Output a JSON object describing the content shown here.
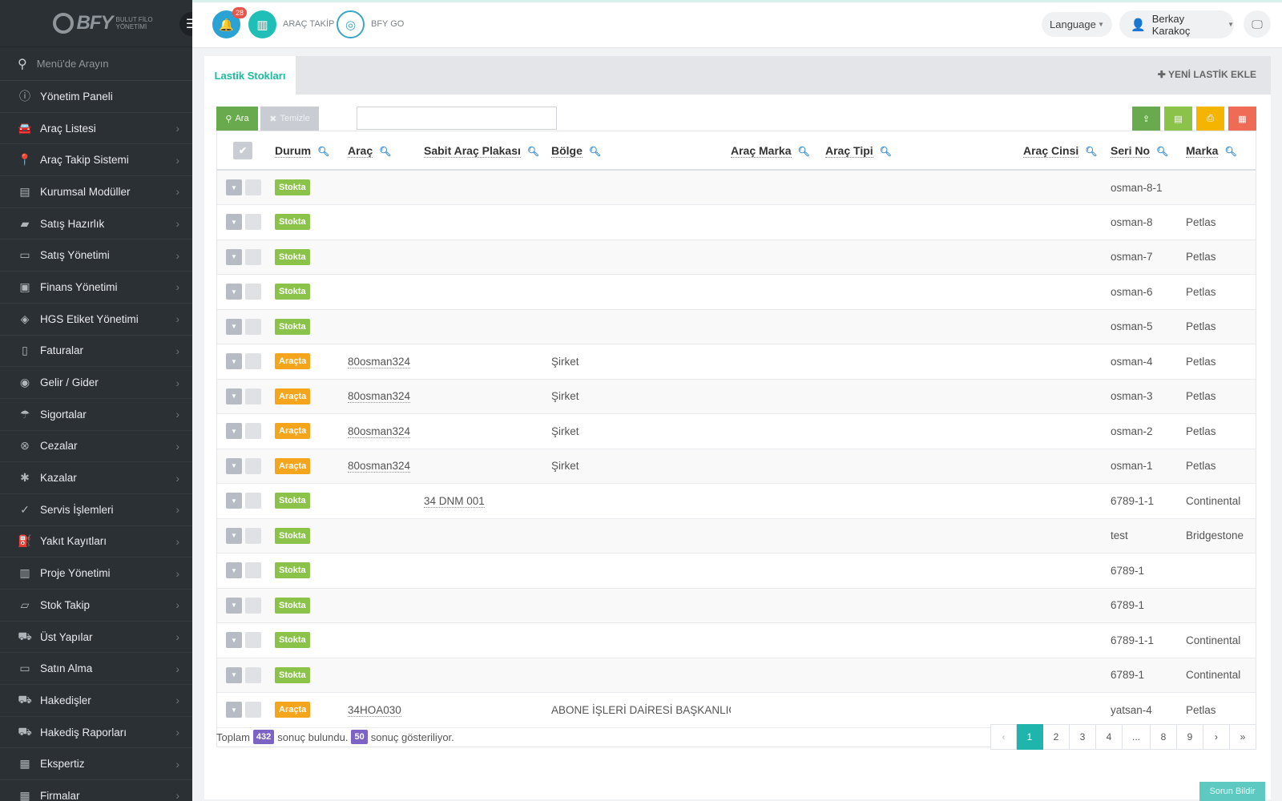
{
  "brand": {
    "name": "BFY",
    "subtitle": "BULUT FİLO YÖNETİMİ"
  },
  "sidebar": {
    "search_placeholder": "Menü'de Arayın",
    "items": [
      {
        "label": "Yönetim Paneli",
        "icon": "info-circle-icon",
        "chevron": false
      },
      {
        "label": "Araç Listesi",
        "icon": "car-icon",
        "chevron": true
      },
      {
        "label": "Araç Takip Sistemi",
        "icon": "map-pin-icon",
        "chevron": true
      },
      {
        "label": "Kurumsal Modüller",
        "icon": "server-icon",
        "chevron": true
      },
      {
        "label": "Satış Hazırlık",
        "icon": "book-icon",
        "chevron": true
      },
      {
        "label": "Satış Yönetimi",
        "icon": "credit-card-icon",
        "chevron": true
      },
      {
        "label": "Finans Yönetimi",
        "icon": "money-icon",
        "chevron": true
      },
      {
        "label": "HGS Etiket Yönetimi",
        "icon": "tag-icon",
        "chevron": true
      },
      {
        "label": "Faturalar",
        "icon": "file-icon",
        "chevron": true
      },
      {
        "label": "Gelir / Gider",
        "icon": "coins-icon",
        "chevron": true
      },
      {
        "label": "Sigortalar",
        "icon": "umbrella-icon",
        "chevron": true
      },
      {
        "label": "Cezalar",
        "icon": "x-circle-icon",
        "chevron": true
      },
      {
        "label": "Kazalar",
        "icon": "car-crash-icon",
        "chevron": true
      },
      {
        "label": "Servis İşlemleri",
        "icon": "check-circle-icon",
        "chevron": true
      },
      {
        "label": "Yakıt Kayıtları",
        "icon": "fuel-icon",
        "chevron": true
      },
      {
        "label": "Proje Yönetimi",
        "icon": "briefcase-icon",
        "chevron": true
      },
      {
        "label": "Stok Takip",
        "icon": "inbox-icon",
        "chevron": true
      },
      {
        "label": "Üst Yapılar",
        "icon": "truck-icon",
        "chevron": true
      },
      {
        "label": "Satın Alma",
        "icon": "credit-card-icon",
        "chevron": true
      },
      {
        "label": "Hakedişler",
        "icon": "truck-icon",
        "chevron": true
      },
      {
        "label": "Hakediş Raporları",
        "icon": "truck-icon",
        "chevron": true
      },
      {
        "label": "Ekspertiz",
        "icon": "document-icon",
        "chevron": true
      },
      {
        "label": "Firmalar",
        "icon": "building-icon",
        "chevron": true
      }
    ]
  },
  "topbar": {
    "notifications_count": "28",
    "arac_takip_label": "ARAÇ TAKİP",
    "bfy_go_label": "BFY GO",
    "language_label": "Language",
    "user_name": "Berkay Karakoç"
  },
  "panel": {
    "tab_label": "Lastik Stokları",
    "new_tire_label": "YENİ LASTİK EKLE",
    "search_button": "Ara",
    "clear_button": "Temizle",
    "search_value": ""
  },
  "table": {
    "columns": [
      "Durum",
      "Araç",
      "Sabit Araç Plakası",
      "Bölge",
      "Araç Marka",
      "Araç Tipi",
      "Araç Cinsi",
      "Seri No",
      "Marka"
    ],
    "rows": [
      {
        "durum": "Stokta",
        "status": "stok",
        "arac": "",
        "plaka": "",
        "bolge": "",
        "seri": "osman-8-1",
        "marka": ""
      },
      {
        "durum": "Stokta",
        "status": "stok",
        "arac": "",
        "plaka": "",
        "bolge": "",
        "seri": "osman-8",
        "marka": "Petlas"
      },
      {
        "durum": "Stokta",
        "status": "stok",
        "arac": "",
        "plaka": "",
        "bolge": "",
        "seri": "osman-7",
        "marka": "Petlas"
      },
      {
        "durum": "Stokta",
        "status": "stok",
        "arac": "",
        "plaka": "",
        "bolge": "",
        "seri": "osman-6",
        "marka": "Petlas"
      },
      {
        "durum": "Stokta",
        "status": "stok",
        "arac": "",
        "plaka": "",
        "bolge": "",
        "seri": "osman-5",
        "marka": "Petlas"
      },
      {
        "durum": "Araçta",
        "status": "arac",
        "arac": "80osman324",
        "plaka": "",
        "bolge": "Şirket",
        "seri": "osman-4",
        "marka": "Petlas"
      },
      {
        "durum": "Araçta",
        "status": "arac",
        "arac": "80osman324",
        "plaka": "",
        "bolge": "Şirket",
        "seri": "osman-3",
        "marka": "Petlas"
      },
      {
        "durum": "Araçta",
        "status": "arac",
        "arac": "80osman324",
        "plaka": "",
        "bolge": "Şirket",
        "seri": "osman-2",
        "marka": "Petlas"
      },
      {
        "durum": "Araçta",
        "status": "arac",
        "arac": "80osman324",
        "plaka": "",
        "bolge": "Şirket",
        "seri": "osman-1",
        "marka": "Petlas"
      },
      {
        "durum": "Stokta",
        "status": "stok",
        "arac": "",
        "plaka": "34 DNM 001",
        "bolge": "",
        "seri": "6789-1-1",
        "marka": "Continental"
      },
      {
        "durum": "Stokta",
        "status": "stok",
        "arac": "",
        "plaka": "",
        "bolge": "",
        "seri": "test",
        "marka": "Bridgestone"
      },
      {
        "durum": "Stokta",
        "status": "stok",
        "arac": "",
        "plaka": "",
        "bolge": "",
        "seri": "6789-1",
        "marka": ""
      },
      {
        "durum": "Stokta",
        "status": "stok",
        "arac": "",
        "plaka": "",
        "bolge": "",
        "seri": "6789-1",
        "marka": ""
      },
      {
        "durum": "Stokta",
        "status": "stok",
        "arac": "",
        "plaka": "",
        "bolge": "",
        "seri": "6789-1-1",
        "marka": "Continental"
      },
      {
        "durum": "Stokta",
        "status": "stok",
        "arac": "",
        "plaka": "",
        "bolge": "",
        "seri": "6789-1",
        "marka": "Continental"
      },
      {
        "durum": "Araçta",
        "status": "arac",
        "arac": "34HOA030",
        "plaka": "",
        "bolge": "ABONE İŞLERİ DAİRESİ BAŞKANLIĞI",
        "seri": "yatsan-4",
        "marka": "Petlas"
      }
    ]
  },
  "footer": {
    "total_prefix": "Toplam",
    "total_count": "432",
    "total_suffix": "sonuç bulundu.",
    "shown_count": "50",
    "shown_suffix": "sonuç gösteriliyor.",
    "pages": [
      "‹",
      "1",
      "2",
      "3",
      "4",
      "...",
      "8",
      "9",
      "›",
      "»"
    ],
    "active_page": "1"
  },
  "report_button": "Sorun Bildir"
}
